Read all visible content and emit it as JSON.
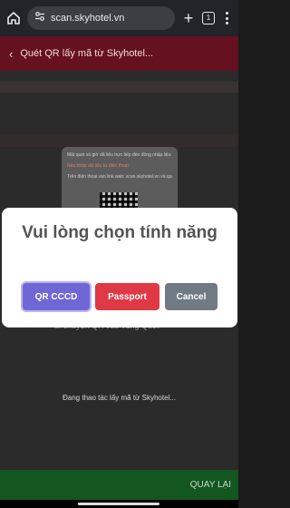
{
  "browser": {
    "url": "scan.skyhotel.vn",
    "tab_count": "1"
  },
  "app_header": {
    "back_glyph": "‹",
    "title": "Quét QR lấy mã từ Skyhotel..."
  },
  "background": {
    "card_line_1": "Mật quét số giờ dã liệu trực tiếp đến đồng nhập liệu khách",
    "card_line_2": "Nếu nhập dữ liệu từ điện thoại",
    "card_line_3": "Trên điện thoại vào link web: scan.skyhotel.vn và quét mã sau:",
    "mid_text": "di chuyển QR vào vùng Quét",
    "loading": "Đang thao tác lấy mã từ Skyhotel..."
  },
  "modal": {
    "title": "Vui lòng chọn tính năng",
    "buttons": {
      "qr": "QR CCCD",
      "passport": "Passport",
      "cancel": "Cancel"
    }
  },
  "bottom_bar": {
    "back_label": "QUAY LẠI"
  },
  "colors": {
    "header": "#66111f",
    "qr_button": "#7067d6",
    "passport_button": "#e03946",
    "cancel_button": "#707a82",
    "bottom_bar": "#14561f"
  }
}
